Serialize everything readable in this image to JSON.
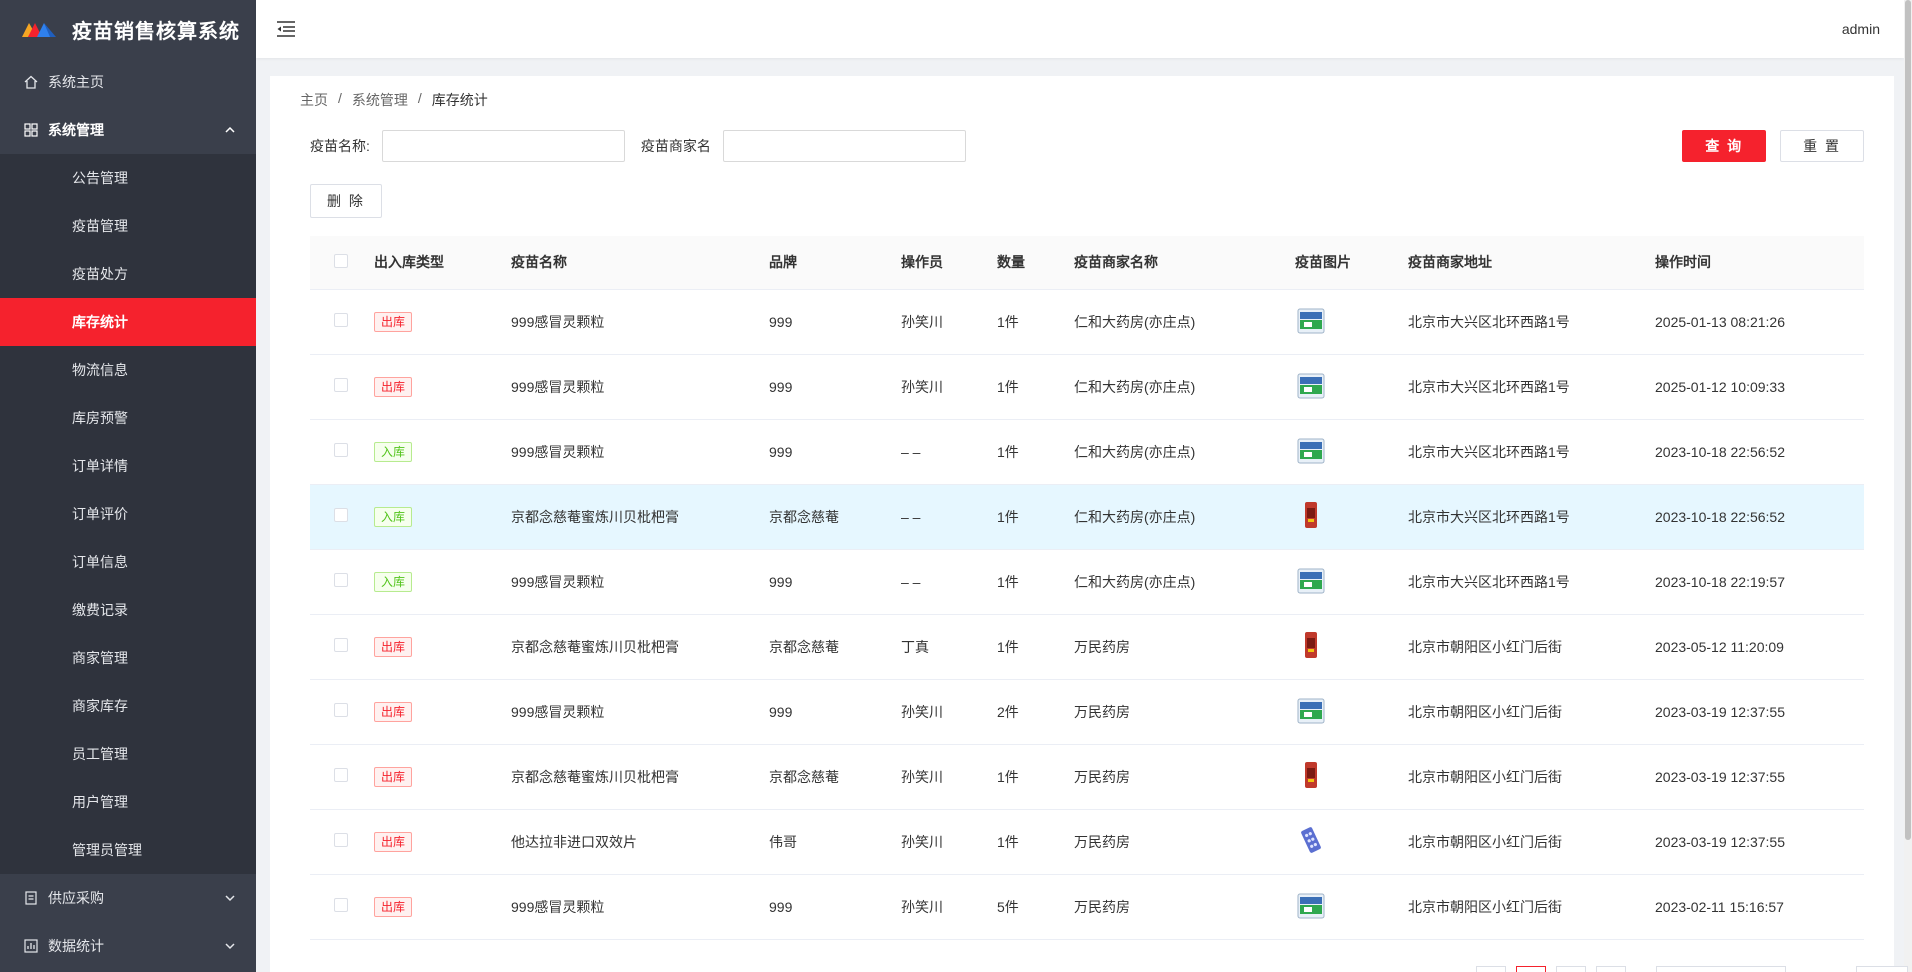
{
  "app": {
    "title": "疫苗销售核算系统",
    "brand_colors": {
      "accent": "#f5222d",
      "sidebar_bg": "#3a3f4b"
    }
  },
  "header": {
    "user": "admin",
    "menu_icon": "menu-fold-icon"
  },
  "sidebar": {
    "items": [
      {
        "label": "系统主页",
        "icon": "home-icon"
      },
      {
        "label": "系统管理",
        "icon": "grid-icon",
        "expanded": true
      },
      {
        "label": "供应采购",
        "icon": "document-icon"
      },
      {
        "label": "数据统计",
        "icon": "chart-icon"
      }
    ],
    "submenu": [
      "公告管理",
      "疫苗管理",
      "疫苗处方",
      "库存统计",
      "物流信息",
      "库房预警",
      "订单详情",
      "订单评价",
      "订单信息",
      "缴费记录",
      "商家管理",
      "商家库存",
      "员工管理",
      "用户管理",
      "管理员管理"
    ],
    "active": "库存统计"
  },
  "breadcrumb": [
    "主页",
    "系统管理",
    "库存统计"
  ],
  "search": {
    "name_label": "疫苗名称:",
    "name_value": "",
    "merchant_label": "疫苗商家名",
    "merchant_value": "",
    "query_label": "查 询",
    "reset_label": "重 置",
    "delete_label": "删 除"
  },
  "table": {
    "columns": [
      "出入库类型",
      "疫苗名称",
      "品牌",
      "操作员",
      "数量",
      "疫苗商家名称",
      "疫苗图片",
      "疫苗商家地址",
      "操作时间"
    ],
    "rows": [
      {
        "type": "出库",
        "kind": "out",
        "name": "999感冒灵颗粒",
        "brand": "999",
        "operator": "孙笑川",
        "qty": "1件",
        "merchant": "仁和大药房(亦庄点)",
        "img": "green-box",
        "address": "北京市大兴区北环西路1号",
        "time": "2025-01-13 08:21:26"
      },
      {
        "type": "出库",
        "kind": "out",
        "name": "999感冒灵颗粒",
        "brand": "999",
        "operator": "孙笑川",
        "qty": "1件",
        "merchant": "仁和大药房(亦庄点)",
        "img": "green-box",
        "address": "北京市大兴区北环西路1号",
        "time": "2025-01-12 10:09:33"
      },
      {
        "type": "入库",
        "kind": "in",
        "name": "999感冒灵颗粒",
        "brand": "999",
        "operator": "– –",
        "qty": "1件",
        "merchant": "仁和大药房(亦庄点)",
        "img": "green-box",
        "address": "北京市大兴区北环西路1号",
        "time": "2023-10-18 22:56:52"
      },
      {
        "type": "入库",
        "kind": "in",
        "name": "京都念慈菴蜜炼川贝枇杷膏",
        "brand": "京都念慈菴",
        "operator": "– –",
        "qty": "1件",
        "merchant": "仁和大药房(亦庄点)",
        "img": "red-bottle",
        "address": "北京市大兴区北环西路1号",
        "time": "2023-10-18 22:56:52",
        "highlight": true
      },
      {
        "type": "入库",
        "kind": "in",
        "name": "999感冒灵颗粒",
        "brand": "999",
        "operator": "– –",
        "qty": "1件",
        "merchant": "仁和大药房(亦庄点)",
        "img": "green-box",
        "address": "北京市大兴区北环西路1号",
        "time": "2023-10-18 22:19:57"
      },
      {
        "type": "出库",
        "kind": "out",
        "name": "京都念慈菴蜜炼川贝枇杷膏",
        "brand": "京都念慈菴",
        "operator": "丁真",
        "qty": "1件",
        "merchant": "万民药房",
        "img": "red-bottle",
        "address": "北京市朝阳区小红门后街",
        "time": "2023-05-12 11:20:09"
      },
      {
        "type": "出库",
        "kind": "out",
        "name": "999感冒灵颗粒",
        "brand": "999",
        "operator": "孙笑川",
        "qty": "2件",
        "merchant": "万民药房",
        "img": "green-box",
        "address": "北京市朝阳区小红门后街",
        "time": "2023-03-19 12:37:55"
      },
      {
        "type": "出库",
        "kind": "out",
        "name": "京都念慈菴蜜炼川贝枇杷膏",
        "brand": "京都念慈菴",
        "operator": "孙笑川",
        "qty": "1件",
        "merchant": "万民药房",
        "img": "red-bottle",
        "address": "北京市朝阳区小红门后街",
        "time": "2023-03-19 12:37:55"
      },
      {
        "type": "出库",
        "kind": "out",
        "name": "他达拉非进口双效片",
        "brand": "伟哥",
        "operator": "孙笑川",
        "qty": "1件",
        "merchant": "万民药房",
        "img": "blue-pills",
        "address": "北京市朝阳区小红门后街",
        "time": "2023-03-19 12:37:55"
      },
      {
        "type": "出库",
        "kind": "out",
        "name": "999感冒灵颗粒",
        "brand": "999",
        "operator": "孙笑川",
        "qty": "5件",
        "merchant": "万民药房",
        "img": "green-box",
        "address": "北京市朝阳区小红门后街",
        "time": "2023-02-11 15:16:57"
      }
    ]
  }
}
